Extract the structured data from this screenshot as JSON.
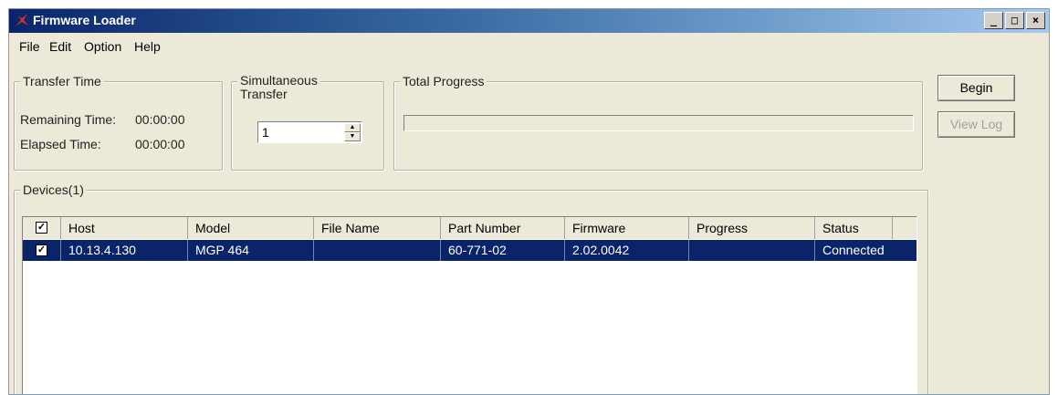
{
  "window": {
    "title": "Firmware Loader",
    "controls": [
      "_",
      "□",
      "×"
    ]
  },
  "menu": [
    "File",
    "Edit",
    "Option",
    "Help"
  ],
  "transfer_time": {
    "label": "Transfer Time",
    "remaining_label": "Remaining Time:",
    "remaining_value": "00:00:00",
    "elapsed_label": "Elapsed Time:",
    "elapsed_value": "00:00:00"
  },
  "simultaneous": {
    "label_line1": "Simultaneous",
    "label_line2": "Transfer",
    "value": "1"
  },
  "total_progress": {
    "label": "Total Progress",
    "fraction": 0
  },
  "buttons": {
    "begin": "Begin",
    "view_log": "View Log"
  },
  "devices": {
    "label": "Devices(1)",
    "columns": [
      "Host",
      "Model",
      "File Name",
      "Part Number",
      "Firmware",
      "Progress",
      "Status"
    ],
    "rows": [
      {
        "checked": true,
        "host": "10.13.4.130",
        "model": "MGP 464",
        "file_name": "",
        "part_number": "60-771-02",
        "firmware": "2.02.0042",
        "progress": "",
        "status": "Connected"
      }
    ]
  },
  "colors": {
    "selection": "#0a246a",
    "window_bg": "#ece9d8"
  }
}
